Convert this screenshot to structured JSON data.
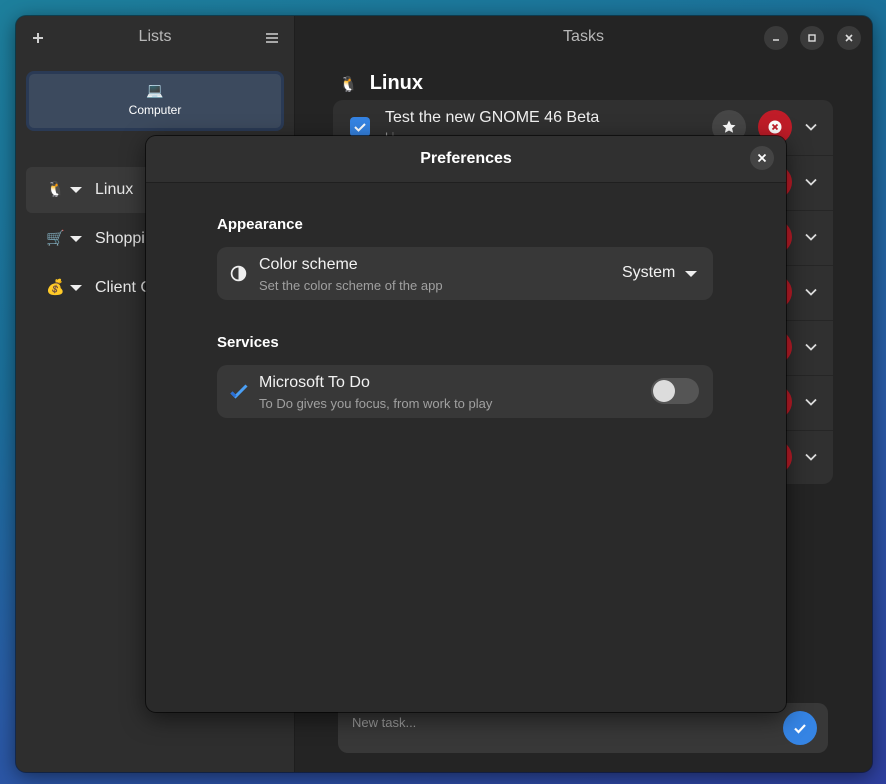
{
  "sidebar": {
    "title": "Lists",
    "add_icon": "plus-icon",
    "menu_icon": "hamburger-menu-icon",
    "provider": {
      "icon": "💻",
      "label": "Computer"
    },
    "lists": [
      {
        "emoji": "🐧",
        "label": "Linux"
      },
      {
        "emoji": "🛒",
        "label": "Shoppi"
      },
      {
        "emoji": "💰",
        "label": "Client C"
      }
    ]
  },
  "main": {
    "title": "Tasks",
    "list_emoji": "🐧",
    "list_title": "Linux",
    "first_task": {
      "title": "Test the new GNOME 46 Beta",
      "subtitle": "Li"
    },
    "new_task_placeholder": "New task..."
  },
  "preferences": {
    "title": "Preferences",
    "appearance": {
      "section": "Appearance",
      "color_scheme_title": "Color scheme",
      "color_scheme_subtitle": "Set the color scheme of the app",
      "color_scheme_value": "System"
    },
    "services": {
      "section": "Services",
      "mstodo_title": "Microsoft To Do",
      "mstodo_subtitle": "To Do gives you focus, from work to play",
      "mstodo_enabled": false
    }
  },
  "colors": {
    "accent": "#3584e4",
    "destructive": "#c01c28"
  }
}
